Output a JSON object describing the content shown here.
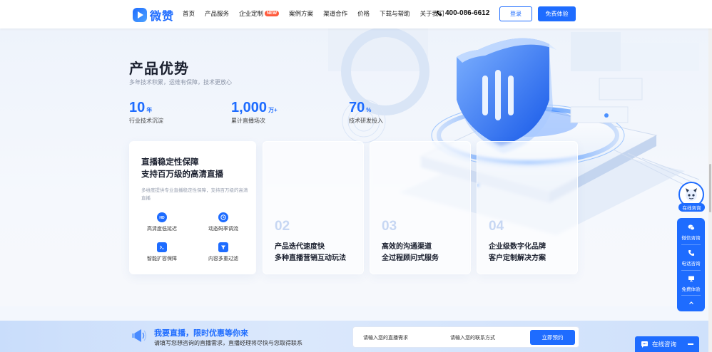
{
  "header": {
    "logo_text": "微赞",
    "nav": [
      {
        "label": "首页"
      },
      {
        "label": "产品服务"
      },
      {
        "label": "企业定制",
        "badge": "NEW"
      },
      {
        "label": "案例方案"
      },
      {
        "label": "渠道合作"
      },
      {
        "label": "价格"
      },
      {
        "label": "下载与帮助"
      },
      {
        "label": "关于我们"
      }
    ],
    "phone": "400-086-6612",
    "login_label": "登录",
    "free_trial_label": "免费体验"
  },
  "hero": {
    "title": "产品优势",
    "subtitle": "多年技术积累，运维有保障，技术更放心",
    "stats": [
      {
        "value": "10",
        "unit": "年",
        "label": "行业技术沉淀"
      },
      {
        "value": "1,000",
        "unit": "万+",
        "label": "累计直播场次"
      },
      {
        "value": "70",
        "unit": "%",
        "label": "技术研发投入"
      }
    ]
  },
  "cards": {
    "main": {
      "title_line1": "直播稳定性保障",
      "title_line2": "支持百万级的高清直播",
      "description": "多维度提供专业直播稳定性保障，支持百万级的高清直播",
      "features": [
        {
          "label": "高清度低延迟",
          "icon": "hd-icon"
        },
        {
          "label": "动态码率调流",
          "icon": "clock-icon"
        },
        {
          "label": "智能扩容保障",
          "icon": "terminal-icon"
        },
        {
          "label": "内容多重过滤",
          "icon": "filter-icon"
        }
      ]
    },
    "others": [
      {
        "num": "02",
        "line1": "产品迭代速度快",
        "line2": "多种直播营销互动玩法"
      },
      {
        "num": "03",
        "line1": "高效的沟通渠道",
        "line2": "全过程顾问式服务"
      },
      {
        "num": "04",
        "line1": "企业级数字化品牌",
        "line2": "客户定制解决方案"
      }
    ]
  },
  "banner": {
    "title": "我要直播，限时优惠等你来",
    "subtitle": "请填写您想咨询的直播需求，直播经理将尽快与您取得联系",
    "input1_placeholder": "请输入您的直播需求",
    "input2_placeholder": "请输入您的联系方式",
    "submit_label": "立即预约"
  },
  "float": {
    "online_label": "在线咨询",
    "items": [
      {
        "label": "微信咨询",
        "icon": "wechat-icon"
      },
      {
        "label": "电话咨询",
        "icon": "phone-icon"
      },
      {
        "label": "免费体验",
        "icon": "monitor-icon"
      }
    ],
    "chat_label": "在线咨询"
  },
  "colors": {
    "brand": "#1e6cff",
    "badge": "#ff5a3c"
  }
}
